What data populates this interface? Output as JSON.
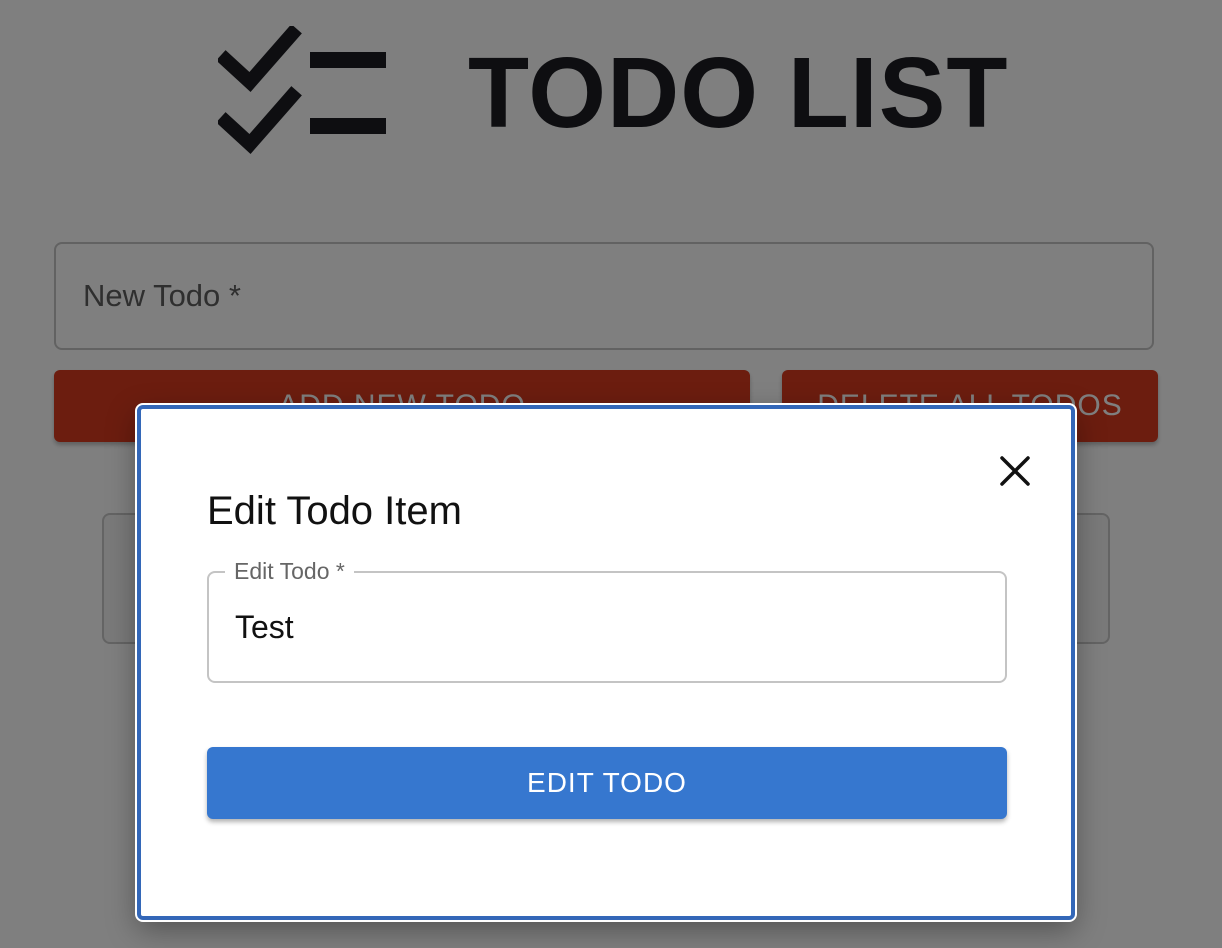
{
  "app": {
    "title": "TODO LIST",
    "logo_icon": "checklist-icon"
  },
  "new_todo": {
    "label": "New Todo *",
    "value": ""
  },
  "buttons": {
    "add_label": "ADD NEW TODO",
    "delete_all_label": "DELETE ALL TODOS"
  },
  "modal": {
    "title": "Edit Todo Item",
    "close_icon": "close-icon",
    "field_label": "Edit Todo *",
    "field_value": "Test",
    "submit_label": "EDIT TODO"
  },
  "colors": {
    "danger": "#d93a1e",
    "primary": "#3677cf",
    "modal_border": "#3367b8",
    "title_text": "#1c1d22"
  }
}
